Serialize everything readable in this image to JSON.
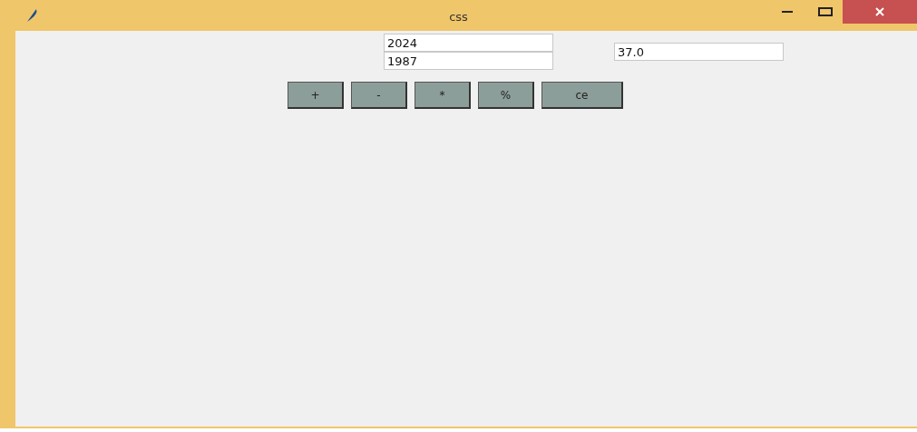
{
  "window": {
    "title": "css"
  },
  "inputs": [
    {
      "value": "2024"
    },
    {
      "value": "1987"
    }
  ],
  "result": {
    "value": "37.0"
  },
  "buttons": [
    "+",
    "-",
    "*",
    "%",
    "ce"
  ]
}
